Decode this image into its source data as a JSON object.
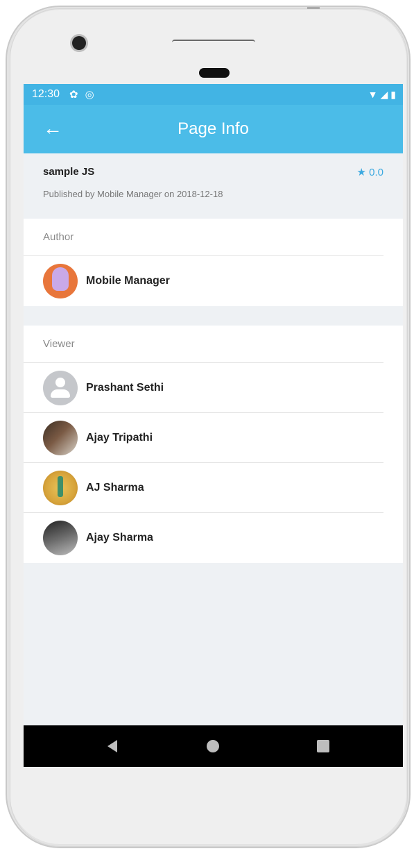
{
  "status_bar": {
    "time": "12:30",
    "icons": [
      "settings-icon",
      "sync-icon",
      "wifi-icon",
      "signal-icon",
      "battery-icon"
    ]
  },
  "app_bar": {
    "title": "Page Info",
    "back_icon": "arrow-left-icon"
  },
  "page": {
    "name": "sample JS",
    "rating": "0.0",
    "published": "Published by Mobile Manager on 2018-12-18"
  },
  "author": {
    "header": "Author",
    "name": "Mobile Manager"
  },
  "viewers": {
    "header": "Viewer",
    "items": [
      {
        "name": "Prashant Sethi"
      },
      {
        "name": "Ajay Tripathi"
      },
      {
        "name": "AJ Sharma"
      },
      {
        "name": "Ajay Sharma"
      }
    ]
  },
  "nav": {
    "back": "back-icon",
    "home": "home-icon",
    "recent": "recents-icon"
  },
  "colors": {
    "accent": "#4bbce8",
    "status_bar": "#42b4e4",
    "rating": "#3ba9e0",
    "background": "#eef1f4"
  }
}
